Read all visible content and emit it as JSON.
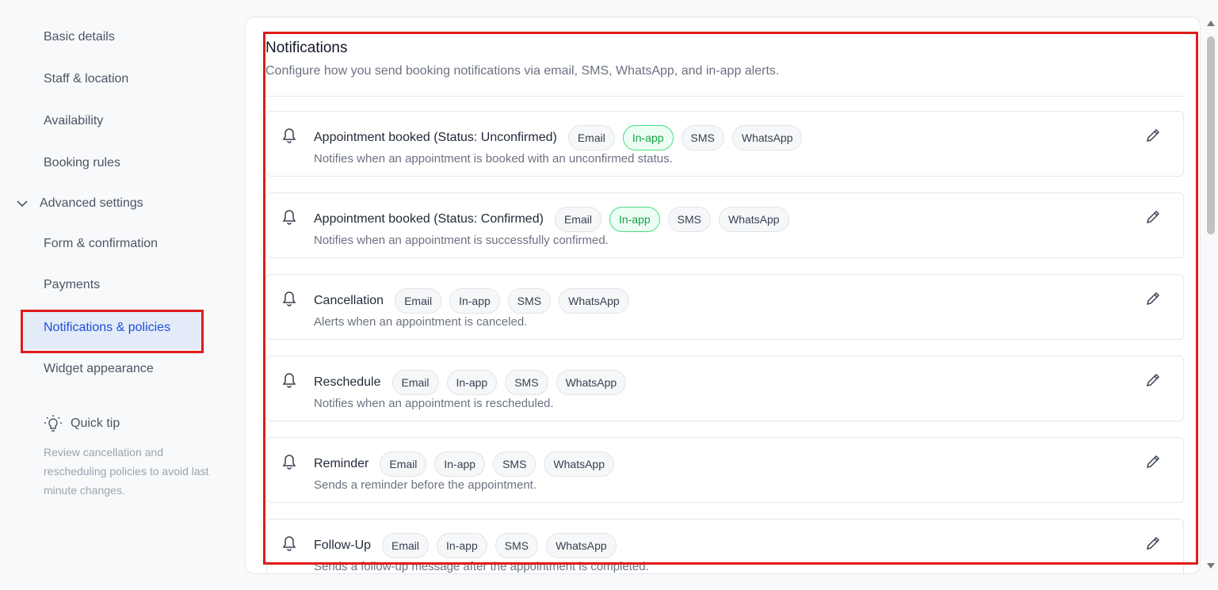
{
  "sidebar": {
    "items": [
      "Basic details",
      "Staff & location",
      "Availability",
      "Booking rules"
    ],
    "advanced": "Advanced settings",
    "sub_items": [
      "Form & confirmation",
      "Payments",
      "Notifications & policies",
      "Widget appearance"
    ],
    "active": "Notifications & policies",
    "tip_title": "Quick tip",
    "tip_text": "Review cancellation and rescheduling policies to avoid last minute changes."
  },
  "main": {
    "title": "Notifications",
    "description": "Configure how you send booking notifications via email, SMS, WhatsApp, and in-app alerts.",
    "rows": [
      {
        "title": "Appointment booked (Status: Unconfirmed)",
        "desc": "Notifies when an appointment is booked with an unconfirmed status.",
        "channels": [
          "Email",
          "In-app",
          "SMS",
          "WhatsApp"
        ],
        "active": [
          "In-app"
        ]
      },
      {
        "title": "Appointment booked (Status: Confirmed)",
        "desc": "Notifies when an appointment is successfully confirmed.",
        "channels": [
          "Email",
          "In-app",
          "SMS",
          "WhatsApp"
        ],
        "active": [
          "In-app"
        ]
      },
      {
        "title": "Cancellation",
        "desc": "Alerts when an appointment is canceled.",
        "channels": [
          "Email",
          "In-app",
          "SMS",
          "WhatsApp"
        ],
        "active": []
      },
      {
        "title": "Reschedule",
        "desc": "Notifies when an appointment is rescheduled.",
        "channels": [
          "Email",
          "In-app",
          "SMS",
          "WhatsApp"
        ],
        "active": []
      },
      {
        "title": "Reminder",
        "desc": "Sends a reminder before the appointment.",
        "channels": [
          "Email",
          "In-app",
          "SMS",
          "WhatsApp"
        ],
        "active": []
      },
      {
        "title": "Follow-Up",
        "desc": "Sends a follow-up message after the appointment is completed.",
        "channels": [
          "Email",
          "In-app",
          "SMS",
          "WhatsApp"
        ],
        "active": []
      }
    ]
  },
  "colors": {
    "accent": "#1d4ed8",
    "active_channel": "#16a34a",
    "annotation": "#e01b1b"
  }
}
